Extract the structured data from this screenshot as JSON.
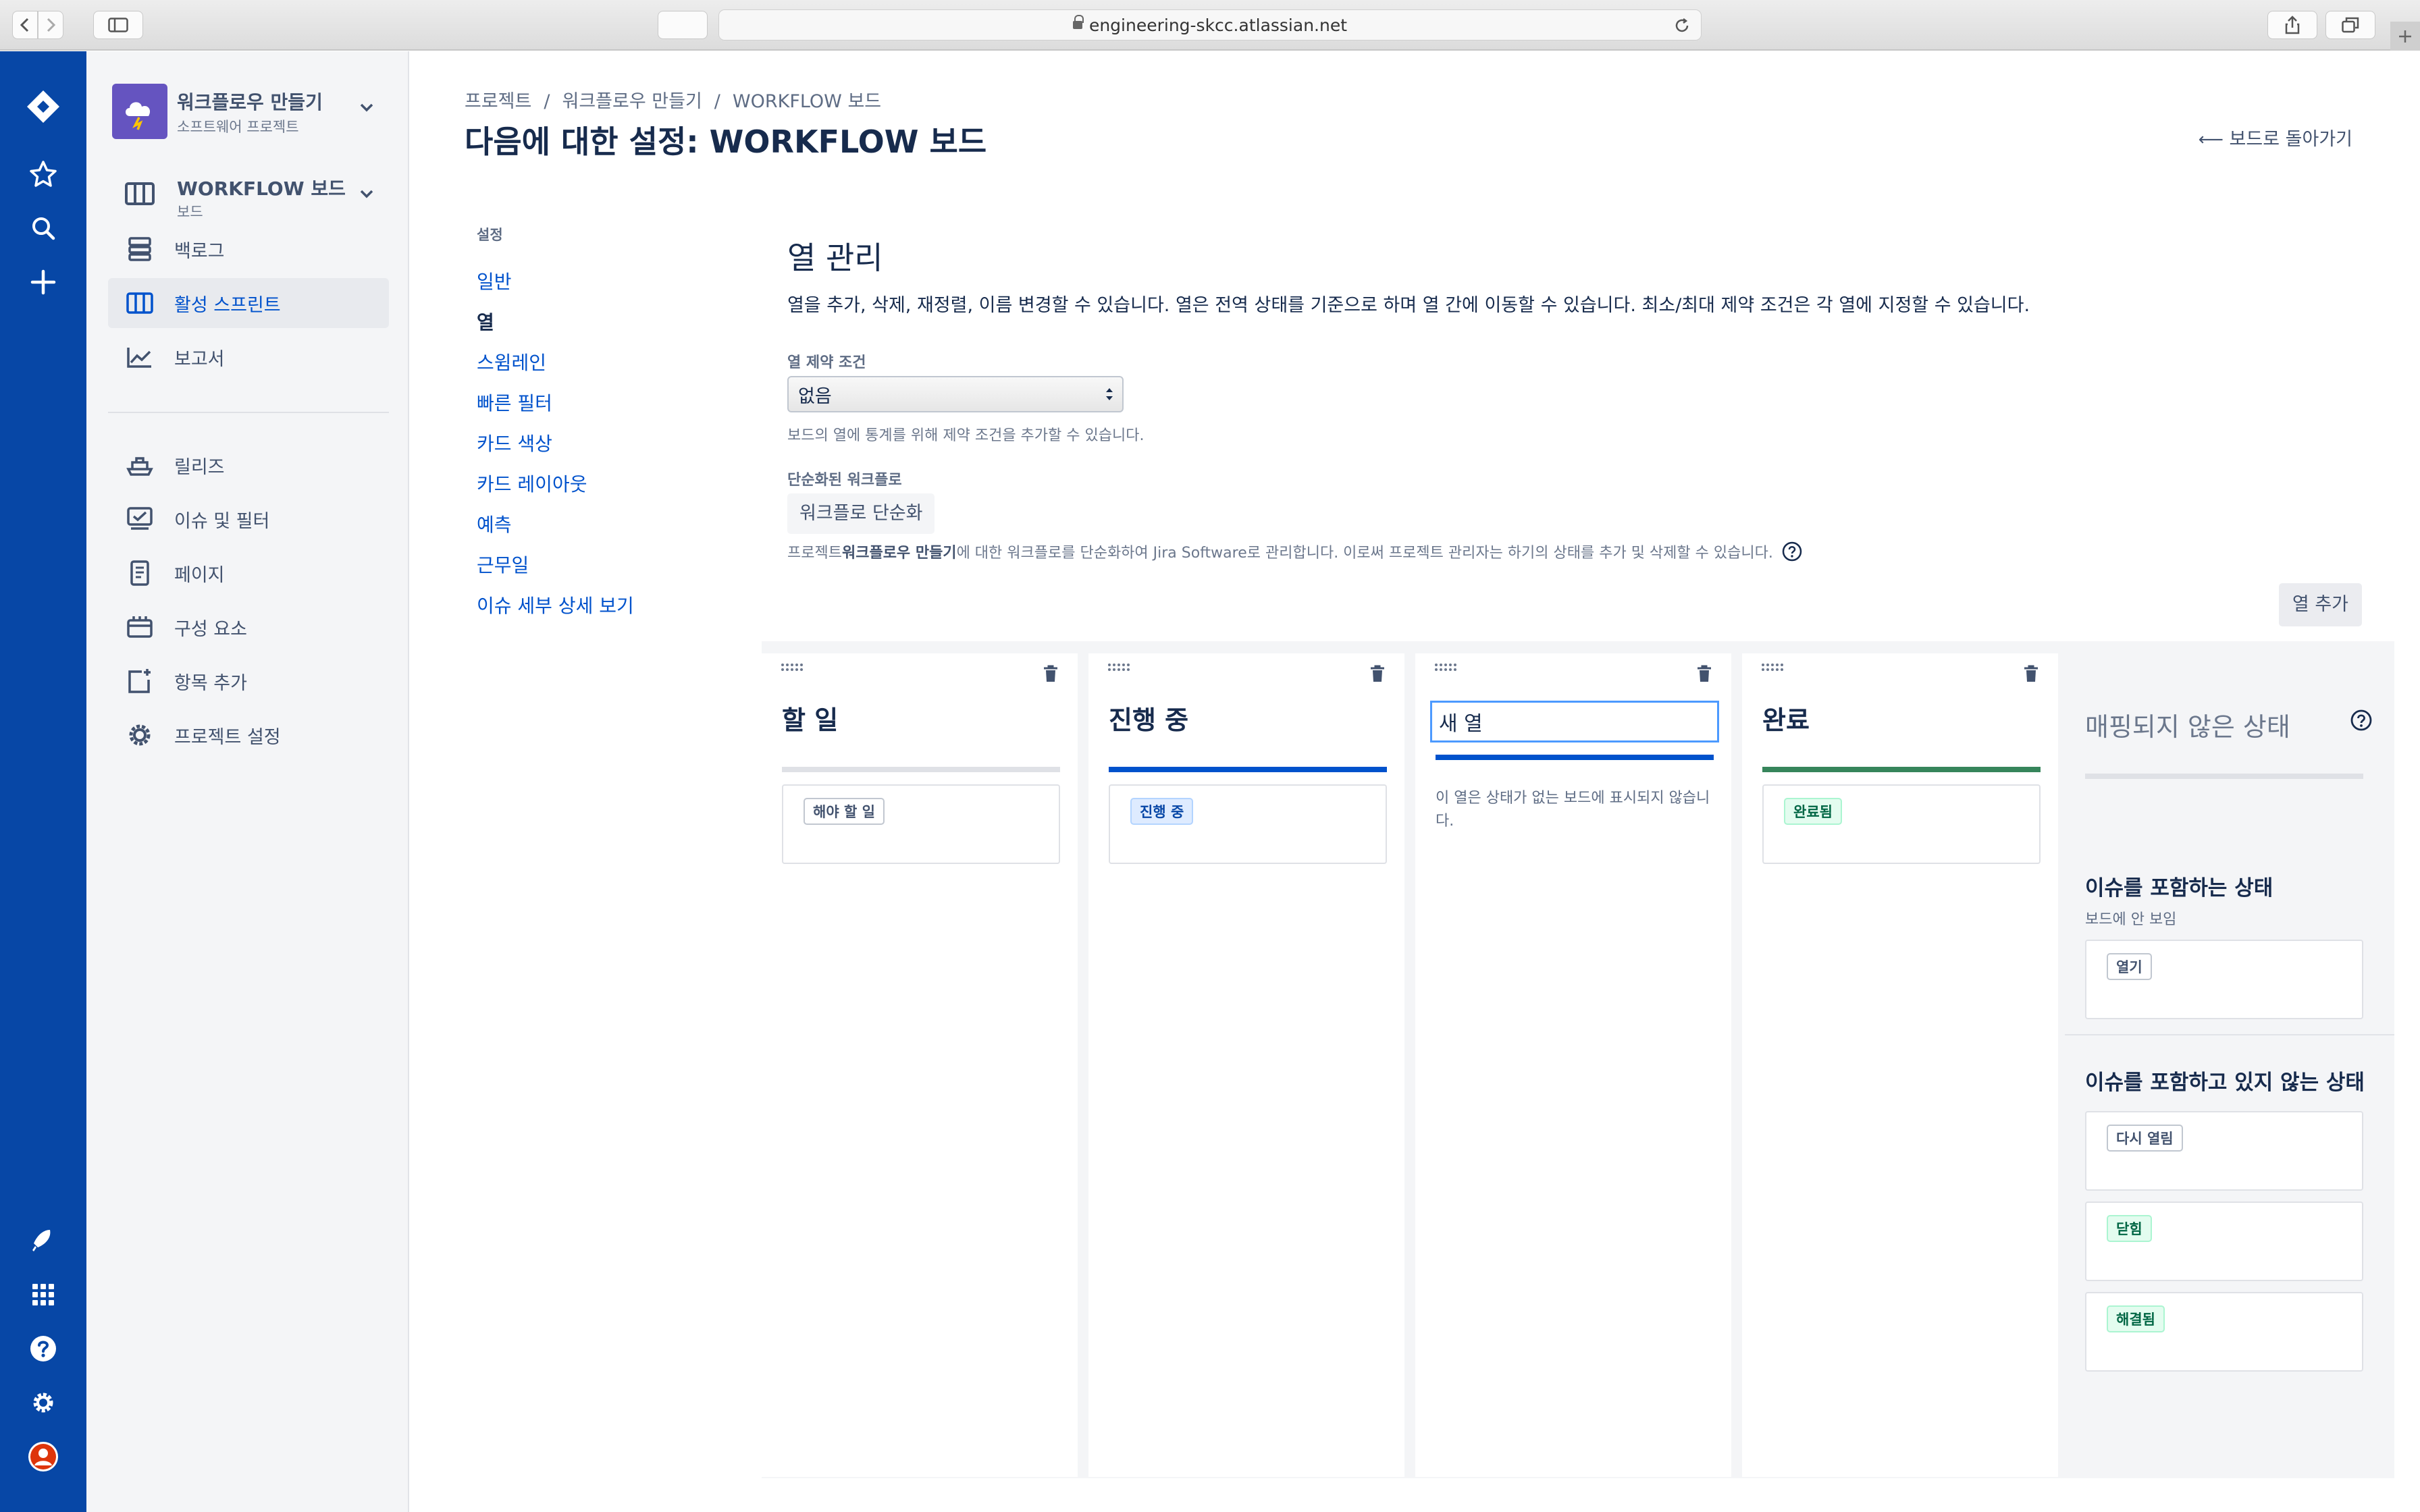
{
  "browser": {
    "url": "engineering-skcc.atlassian.net"
  },
  "project": {
    "name": "워크플로우 만들기",
    "type": "소프트웨어 프로젝트",
    "board_name": "WORKFLOW 보드",
    "board_type": "보드"
  },
  "sidebar": {
    "items": [
      {
        "label": "백로그",
        "icon": "backlog-icon"
      },
      {
        "label": "활성 스프린트",
        "icon": "board-icon",
        "active": true
      },
      {
        "label": "보고서",
        "icon": "reports-icon"
      },
      {
        "label": "릴리즈",
        "icon": "ship-icon"
      },
      {
        "label": "이슈 및 필터",
        "icon": "issues-icon"
      },
      {
        "label": "페이지",
        "icon": "page-icon"
      },
      {
        "label": "구성 요소",
        "icon": "component-icon"
      },
      {
        "label": "항목 추가",
        "icon": "add-item-icon"
      },
      {
        "label": "프로젝트 설정",
        "icon": "gear-icon"
      }
    ]
  },
  "header": {
    "breadcrumbs": [
      "프로젝트",
      "워크플로우 만들기",
      "WORKFLOW 보드"
    ],
    "title": "다음에 대한 설정: WORKFLOW 보드",
    "back_link": "보드로 돌아가기"
  },
  "settings_nav": {
    "header": "설정",
    "items": [
      "일반",
      "열",
      "스윔레인",
      "빠른 필터",
      "카드 색상",
      "카드 레이아웃",
      "예측",
      "근무일",
      "이슈 세부 상세 보기"
    ],
    "current": "열"
  },
  "column_mgmt": {
    "title": "열 관리",
    "description": "열을 추가, 삭제, 재정렬, 이름 변경할 수 있습니다. 열은 전역 상태를 기준으로 하며 열 간에 이동할 수 있습니다. 최소/최대 제약 조건은 각 열에 지정할 수 있습니다.",
    "constraint_label": "열 제약 조건",
    "constraint_value": "없음",
    "constraint_help": "보드의 열에 통계를 위해 제약 조건을 추가할 수 있습니다.",
    "simplified_label": "단순화된 워크플로",
    "simplify_button": "워크플로 단순화",
    "simplify_help_pre": "프로젝트 ",
    "simplify_help_bold": "워크플로우 만들기",
    "simplify_help_post": "에 대한 워크플로를 단순화하여 Jira Software로 관리합니다. 이로써 프로젝트 관리자는 하기의 상태를 추가 및 삭제할 수 있습니다.",
    "add_column_button": "열 추가"
  },
  "columns": [
    {
      "name": "할 일",
      "bar_color": "#dfe1e6",
      "status": "해야 할 일",
      "lozenge": "grey"
    },
    {
      "name": "진행 중",
      "bar_color": "#0052cc",
      "status": "진행 중",
      "lozenge": "blue"
    },
    {
      "name": "새 열",
      "bar_color": "#0052cc",
      "editing": true,
      "empty_note": "이 열은 상태가 없는 보드에 표시되지 않습니다."
    },
    {
      "name": "완료",
      "bar_color": "#36855b",
      "status": "완료됨",
      "lozenge": "green"
    }
  ],
  "unmapped": {
    "title": "매핑되지 않은 상태",
    "with_issues_title": "이슈를 포함하는 상태",
    "with_issues_desc": "보드에 안 보임",
    "with_issues": [
      {
        "label": "열기",
        "lozenge": "grey"
      }
    ],
    "without_issues_title": "이슈를 포함하고 있지 않는 상태",
    "without_issues": [
      {
        "label": "다시 열림",
        "lozenge": "grey"
      },
      {
        "label": "닫힘",
        "lozenge": "green"
      },
      {
        "label": "해결됨",
        "lozenge": "green"
      }
    ]
  }
}
